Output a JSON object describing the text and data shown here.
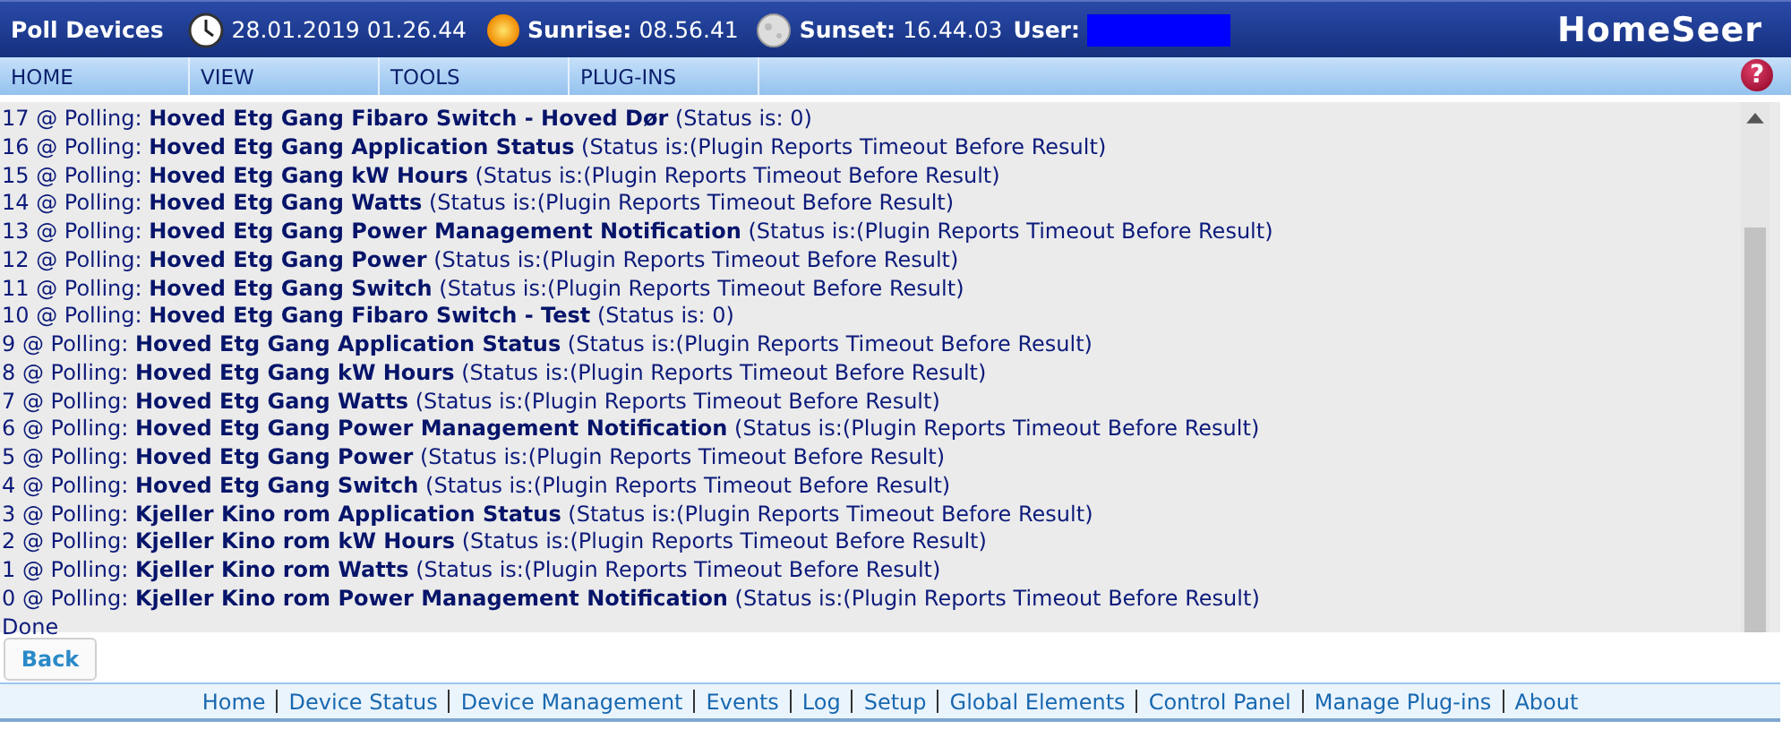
{
  "header": {
    "title": "Poll Devices",
    "datetime": "28.01.2019 01.26.44",
    "sunrise_label": "Sunrise:",
    "sunrise": "08.56.41",
    "sunset_label": "Sunset:",
    "sunset": "16.44.03",
    "user_label": "User:",
    "logo": "HomeSeer"
  },
  "menu": [
    {
      "label": "HOME"
    },
    {
      "label": "VIEW"
    },
    {
      "label": "TOOLS"
    },
    {
      "label": "PLUG-INS"
    }
  ],
  "help": "?",
  "log": [
    "17 @ Polling: **Hoved Etg Gang Fibaro Switch - Hoved Dør** (Status is: 0)",
    "16 @ Polling: **Hoved Etg Gang Application Status** (Status is:(Plugin Reports Timeout Before Result)",
    "15 @ Polling: **Hoved Etg Gang kW Hours** (Status is:(Plugin Reports Timeout Before Result)",
    "14 @ Polling: **Hoved Etg Gang Watts** (Status is:(Plugin Reports Timeout Before Result)",
    "13 @ Polling: **Hoved Etg Gang Power Management Notification** (Status is:(Plugin Reports Timeout Before Result)",
    "12 @ Polling: **Hoved Etg Gang Power** (Status is:(Plugin Reports Timeout Before Result)",
    "11 @ Polling: **Hoved Etg Gang Switch** (Status is:(Plugin Reports Timeout Before Result)",
    "10 @ Polling: **Hoved Etg Gang Fibaro Switch - Test** (Status is: 0)",
    "9 @ Polling: **Hoved Etg Gang Application Status** (Status is:(Plugin Reports Timeout Before Result)",
    "8 @ Polling: **Hoved Etg Gang kW Hours** (Status is:(Plugin Reports Timeout Before Result)",
    "7 @ Polling: **Hoved Etg Gang Watts** (Status is:(Plugin Reports Timeout Before Result)",
    "6 @ Polling: **Hoved Etg Gang Power Management Notification** (Status is:(Plugin Reports Timeout Before Result)",
    "5 @ Polling: **Hoved Etg Gang Power** (Status is:(Plugin Reports Timeout Before Result)",
    "4 @ Polling: **Hoved Etg Gang Switch** (Status is:(Plugin Reports Timeout Before Result)",
    "3 @ Polling: **Kjeller Kino rom Application Status** (Status is:(Plugin Reports Timeout Before Result)",
    "2 @ Polling: **Kjeller Kino rom kW Hours** (Status is:(Plugin Reports Timeout Before Result)",
    "1 @ Polling: **Kjeller Kino rom Watts** (Status is:(Plugin Reports Timeout Before Result)",
    "0 @ Polling: **Kjeller Kino rom Power Management Notification** (Status is:(Plugin Reports Timeout Before Result)",
    "Done"
  ],
  "back_button": "Back",
  "footer_links": [
    "Home",
    "Device Status",
    "Device Management",
    "Events",
    "Log",
    "Setup",
    "Global Elements",
    "Control Panel",
    "Manage Plug-ins",
    "About"
  ]
}
